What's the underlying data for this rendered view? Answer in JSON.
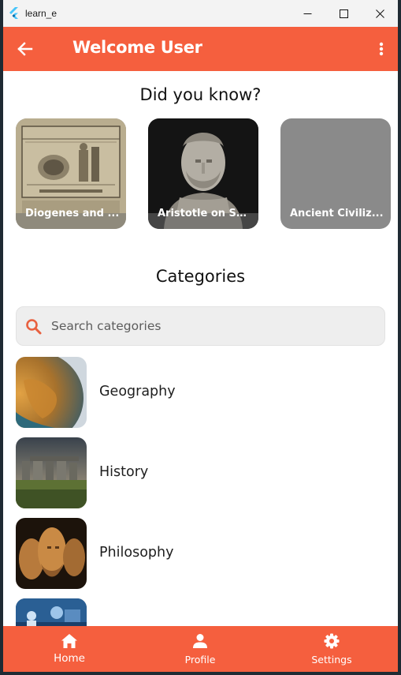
{
  "window": {
    "title": "learn_e",
    "controls": [
      "minimize-icon",
      "maximize-icon",
      "close-icon"
    ]
  },
  "appbar": {
    "title": "Welcome User",
    "back_icon": "arrow-left-icon",
    "menu_icon": "more-vertical-icon",
    "color": "#f55f3e"
  },
  "did_you_know": {
    "title": "Did you know?",
    "cards": [
      {
        "label": "Diogenes and ..."
      },
      {
        "label": "Aristotle on Sel..."
      },
      {
        "label": "Ancient Civiliz..."
      }
    ]
  },
  "categories": {
    "title": "Categories",
    "search": {
      "placeholder": "Search categories",
      "value": "",
      "icon": "search-icon",
      "icon_color": "#e8603f"
    },
    "items": [
      {
        "label": "Geography"
      },
      {
        "label": "History"
      },
      {
        "label": "Philosophy"
      },
      {
        "label": ""
      }
    ]
  },
  "bottom_nav": {
    "items": [
      {
        "label": "Home",
        "icon": "home-icon",
        "active": true
      },
      {
        "label": "Profile",
        "icon": "person-icon",
        "active": false
      },
      {
        "label": "Settings",
        "icon": "gear-icon",
        "active": false
      }
    ]
  }
}
